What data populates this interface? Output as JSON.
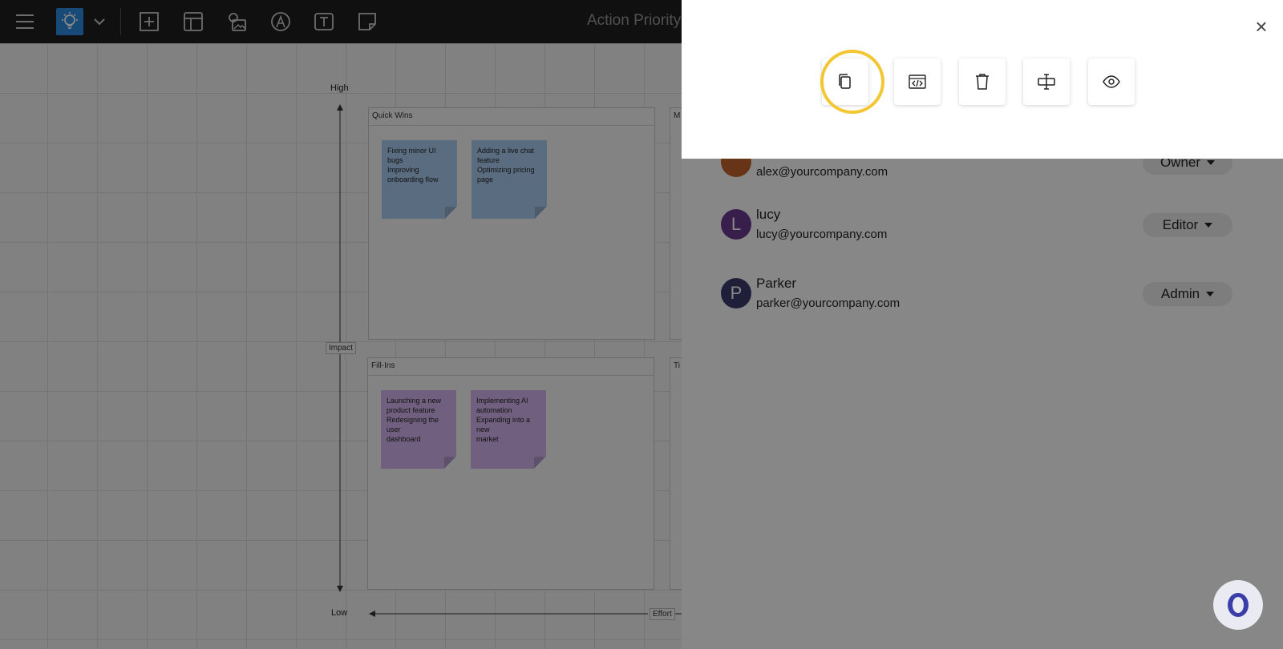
{
  "app": {
    "board_title": "Action Priority"
  },
  "toolbar": {
    "icons": [
      "menu-icon",
      "lightbulb-icon",
      "chevron-down-icon",
      "add-frame-icon",
      "template-icon",
      "media-icon",
      "pen-icon",
      "text-icon",
      "sticky-note-icon"
    ]
  },
  "matrix": {
    "impact_high": "High",
    "impact_low": "Low",
    "impact_axis": "Impact",
    "effort_axis": "Effort",
    "quadrants": {
      "quick_wins": {
        "label": "Quick Wins",
        "notes": [
          {
            "lines": [
              "Fixing minor UI bugs",
              "Improving",
              "onboarding flow"
            ]
          },
          {
            "lines": [
              "Adding a live chat",
              "feature",
              "Optimizing pricing",
              "page"
            ]
          }
        ]
      },
      "major": {
        "label": "M"
      },
      "fill_ins": {
        "label": "Fill-Ins",
        "notes": [
          {
            "lines": [
              "Launching a new",
              "product feature",
              "Redesigning the user",
              "dashboard"
            ]
          },
          {
            "lines": [
              "Implementing AI",
              "automation",
              "Expanding into a new",
              "market"
            ]
          }
        ]
      },
      "thankless": {
        "label": "Ti"
      }
    }
  },
  "share": {
    "actions": [
      "copy-icon",
      "embed-code-icon",
      "trash-icon",
      "rename-icon",
      "eye-icon"
    ],
    "members": [
      {
        "initial": "",
        "name": "",
        "email": "alex@yourcompany.com",
        "role": "Owner",
        "avatar_color": "#c4622d"
      },
      {
        "initial": "L",
        "name": "lucy",
        "email": "lucy@yourcompany.com",
        "role": "Editor",
        "avatar_color": "#6a3a8c"
      },
      {
        "initial": "P",
        "name": "Parker",
        "email": "parker@yourcompany.com",
        "role": "Admin",
        "avatar_color": "#3d3b6e"
      }
    ],
    "close_label": "×"
  },
  "colors": {
    "highlight": "#f3c632",
    "note_blue": "#aacdf0",
    "note_purple": "#d3b4ee"
  }
}
